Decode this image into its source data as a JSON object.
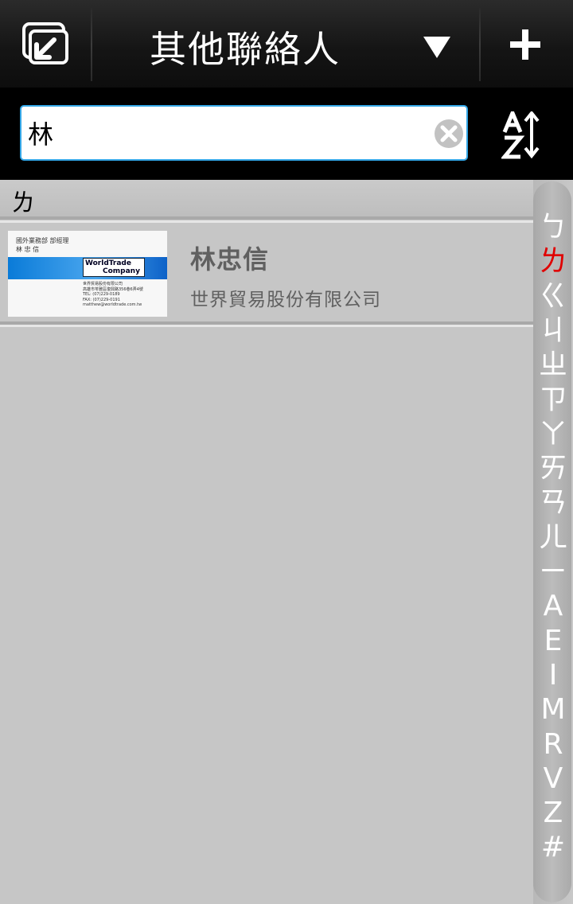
{
  "header": {
    "title": "其他聯絡人",
    "back_icon": "back-icon",
    "dropdown_icon": "triangle-down-icon",
    "add_icon": "plus-icon"
  },
  "search": {
    "value": "林",
    "clear_icon": "clear-icon",
    "sort_icon": "sort-az-icon"
  },
  "list": {
    "section_header": "ㄌ",
    "contacts": [
      {
        "name": "林忠信",
        "company": "世界貿易股份有限公司",
        "card": {
          "line1": "國外業務部  部經理",
          "line2": "林 忠 信",
          "logo_line1": "WorldTrade",
          "logo_line2": "Company",
          "info1": "世界貿易股份有限公司",
          "info2": "高雄市苓雅區復興路356巷6弄4號",
          "info3": "TEL: (07)229-0189",
          "info4": "FAX: (07)229-0191",
          "info5": "matthew@worldtrade.com.tw"
        }
      }
    ]
  },
  "index": {
    "letters": [
      "ㄅ",
      "ㄌ",
      "ㄍ",
      "ㄐ",
      "ㄓ",
      "ㄗ",
      "ㄚ",
      "ㄞ",
      "ㄢ",
      "ㄦ",
      "ㄧ",
      "A",
      "E",
      "I",
      "M",
      "R",
      "V",
      "Z",
      "#"
    ],
    "active": "ㄌ",
    "active_color": "#e00000",
    "color": "#ffffff"
  },
  "colors": {
    "accent": "#33a6e6",
    "background": "#c6c6c6"
  }
}
